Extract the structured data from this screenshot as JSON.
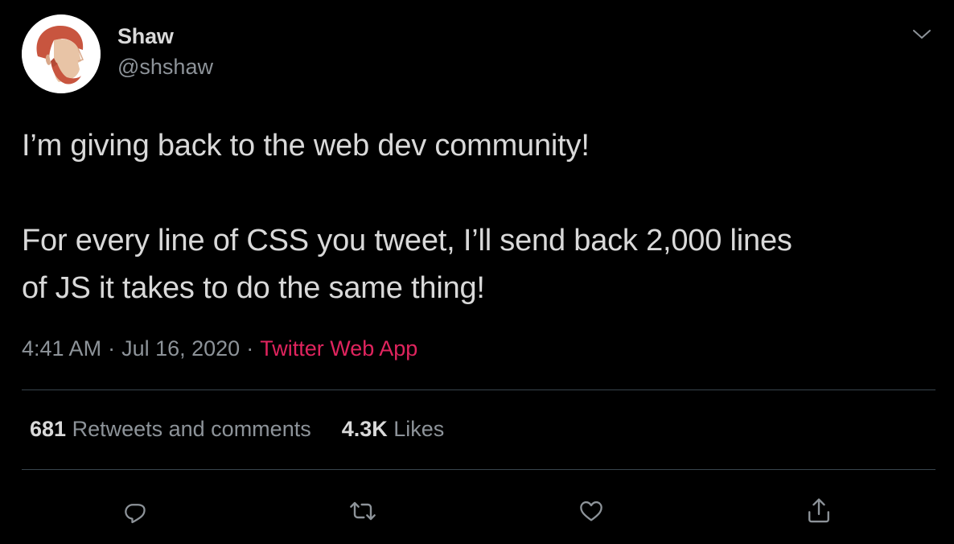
{
  "author": {
    "display_name": "Shaw",
    "handle": "@shshaw",
    "avatar_icon": "bearded-man-avatar"
  },
  "tweet": {
    "lines": [
      "I’m giving back to the web dev community!",
      "",
      "For every line of CSS you tweet, I’ll send back 2,000 lines",
      "of JS it takes to do the same thing!"
    ]
  },
  "meta": {
    "time": "4:41 AM",
    "separator": "·",
    "date": "Jul 16, 2020",
    "source": "Twitter Web App"
  },
  "stats": {
    "retweets_count": "681",
    "retweets_label": "Retweets and comments",
    "likes_count": "4.3K",
    "likes_label": "Likes"
  },
  "actions": [
    {
      "name": "reply",
      "icon": "reply-icon"
    },
    {
      "name": "retweet",
      "icon": "retweet-icon"
    },
    {
      "name": "like",
      "icon": "heart-icon"
    },
    {
      "name": "share",
      "icon": "share-icon"
    }
  ],
  "colors": {
    "background": "#000000",
    "text": "#d9d9d9",
    "secondary_text": "#8d9399",
    "source_link": "#e0245e",
    "divider": "#38444d",
    "avatar_hair": "#c8553f"
  }
}
